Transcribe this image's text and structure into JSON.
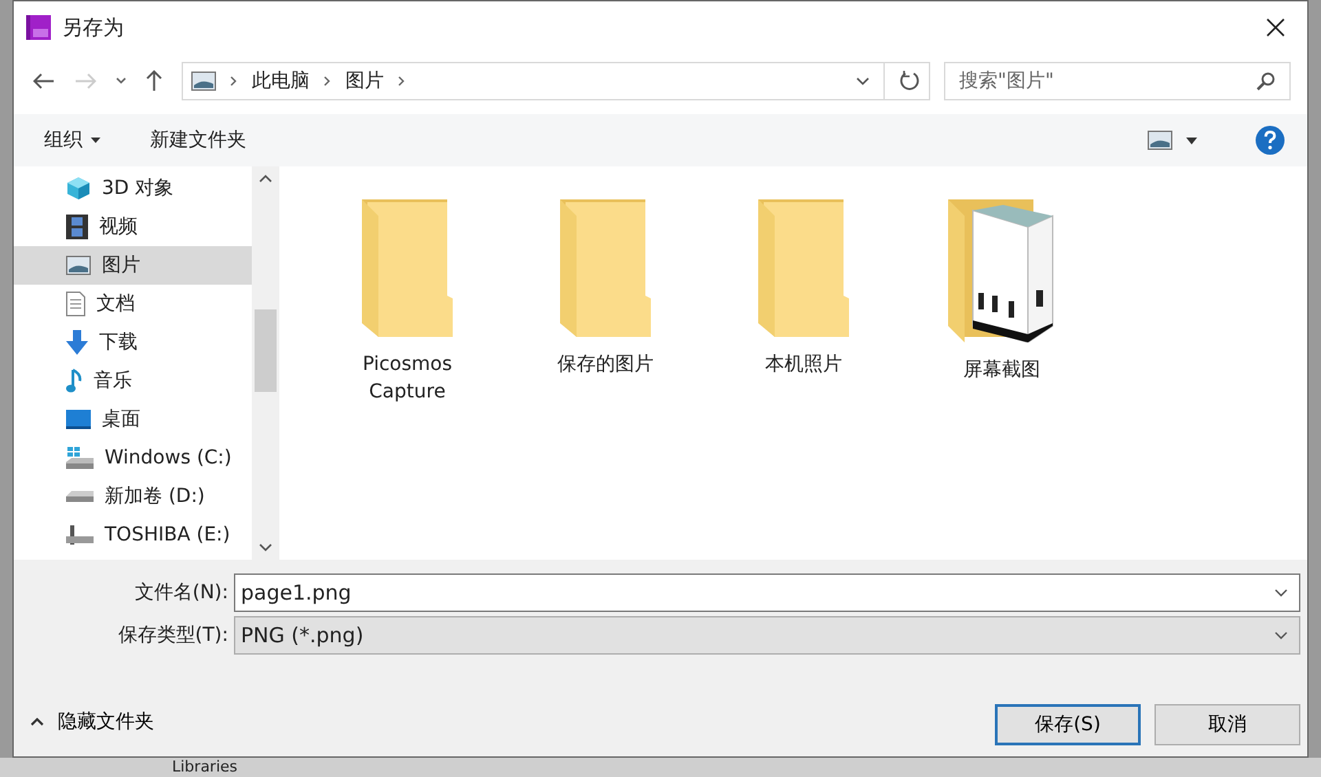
{
  "window": {
    "title": "另存为"
  },
  "address_bar": {
    "path": [
      "此电脑",
      "图片"
    ]
  },
  "search": {
    "placeholder": "搜索\"图片\""
  },
  "toolbar": {
    "organize": "组织",
    "new_folder": "新建文件夹"
  },
  "nav_pane": {
    "items": [
      {
        "label": "3D 对象",
        "kind": "cube",
        "selected": false
      },
      {
        "label": "视频",
        "kind": "film",
        "selected": false
      },
      {
        "label": "图片",
        "kind": "picture",
        "selected": true
      },
      {
        "label": "文档",
        "kind": "document",
        "selected": false
      },
      {
        "label": "下载",
        "kind": "download",
        "selected": false
      },
      {
        "label": "音乐",
        "kind": "music",
        "selected": false
      },
      {
        "label": "桌面",
        "kind": "desktop",
        "selected": false
      },
      {
        "label": "Windows (C:)",
        "kind": "system-drive",
        "selected": false
      },
      {
        "label": "新加卷 (D:)",
        "kind": "drive",
        "selected": false
      },
      {
        "label": "TOSHIBA (E:)",
        "kind": "usb",
        "selected": false
      }
    ]
  },
  "folders": [
    {
      "name": "Picosmos Capture",
      "kind": "plain"
    },
    {
      "name": "保存的图片",
      "kind": "plain"
    },
    {
      "name": "本机照片",
      "kind": "plain"
    },
    {
      "name": "屏幕截图",
      "kind": "preview"
    }
  ],
  "file_name": {
    "label": "文件名(N):",
    "value": "page1.png"
  },
  "file_type": {
    "label": "保存类型(T):",
    "value": "PNG (*.png)"
  },
  "hide_folders": "隐藏文件夹",
  "buttons": [
    {
      "label": "保存(S)",
      "default": true
    },
    {
      "label": "取消",
      "default": false
    }
  ],
  "background": {
    "label": "Libraries"
  }
}
